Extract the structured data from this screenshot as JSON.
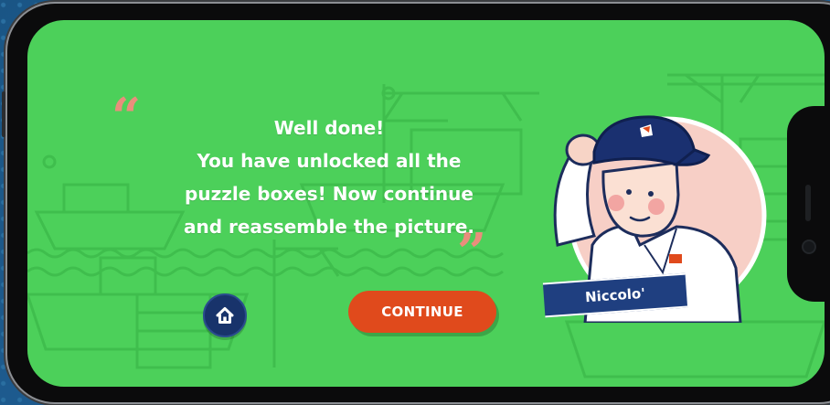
{
  "dialog": {
    "message_lines": [
      "Well done!",
      "You have unlocked all the",
      "puzzle boxes! Now continue",
      "and reassemble the picture."
    ],
    "open_quote": "“",
    "close_quote": "”"
  },
  "buttons": {
    "home_icon": "home-icon",
    "continue_label": "CONTINUE"
  },
  "character": {
    "name": "Niccolo'"
  },
  "colors": {
    "screen_bg": "#4cd05a",
    "continue_bg": "#e04a1c",
    "home_bg": "#18336b",
    "quote_color": "#e98e7c",
    "name_tag_bg": "#1f3f80"
  }
}
